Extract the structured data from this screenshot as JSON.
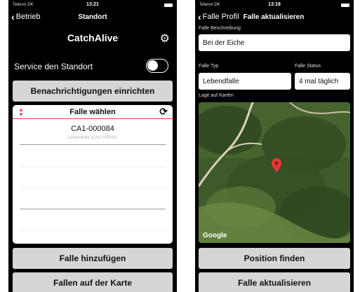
{
  "left_phone": {
    "status": {
      "carrier": "Telenor DK",
      "time": "13:21"
    },
    "nav": {
      "back_label": "Betrieb",
      "title": "Standort"
    },
    "app_title": "CatchAlive",
    "service_label": "Service den Standort",
    "notify_button": "Benachrichtigungen einrichten",
    "trap_panel": {
      "title": "Falle wählen",
      "selected_id": "CA1-000084",
      "selected_sub": "Lebendfalle (CA1-000084)"
    },
    "add_button": "Falle hinzufügen",
    "map_button": "Fallen auf der Karte"
  },
  "right_phone": {
    "status": {
      "carrier": "Telenor DK",
      "time": "13:18"
    },
    "nav": {
      "back_label": "Falle Profil",
      "title": "Falle aktualisieren"
    },
    "description_label": "Falle Beschreibung",
    "description_value": "Bei der Eiche",
    "type_label": "Falle Typ",
    "type_value": "Lebendfalle",
    "status_label": "Falle Status",
    "status_value": "4 mal täglich",
    "map_label": "Lage auf Karten",
    "map_attribution": "Google",
    "find_button": "Position finden",
    "update_button": "Falle aktualisieren"
  },
  "colors": {
    "accent": "#e63946",
    "button_bg": "#d6d6d6",
    "screen_bg": "#000000"
  },
  "icons": [
    "back-chevron-icon",
    "gear-icon",
    "sort-icon",
    "refresh-icon",
    "map-pin-icon"
  ]
}
